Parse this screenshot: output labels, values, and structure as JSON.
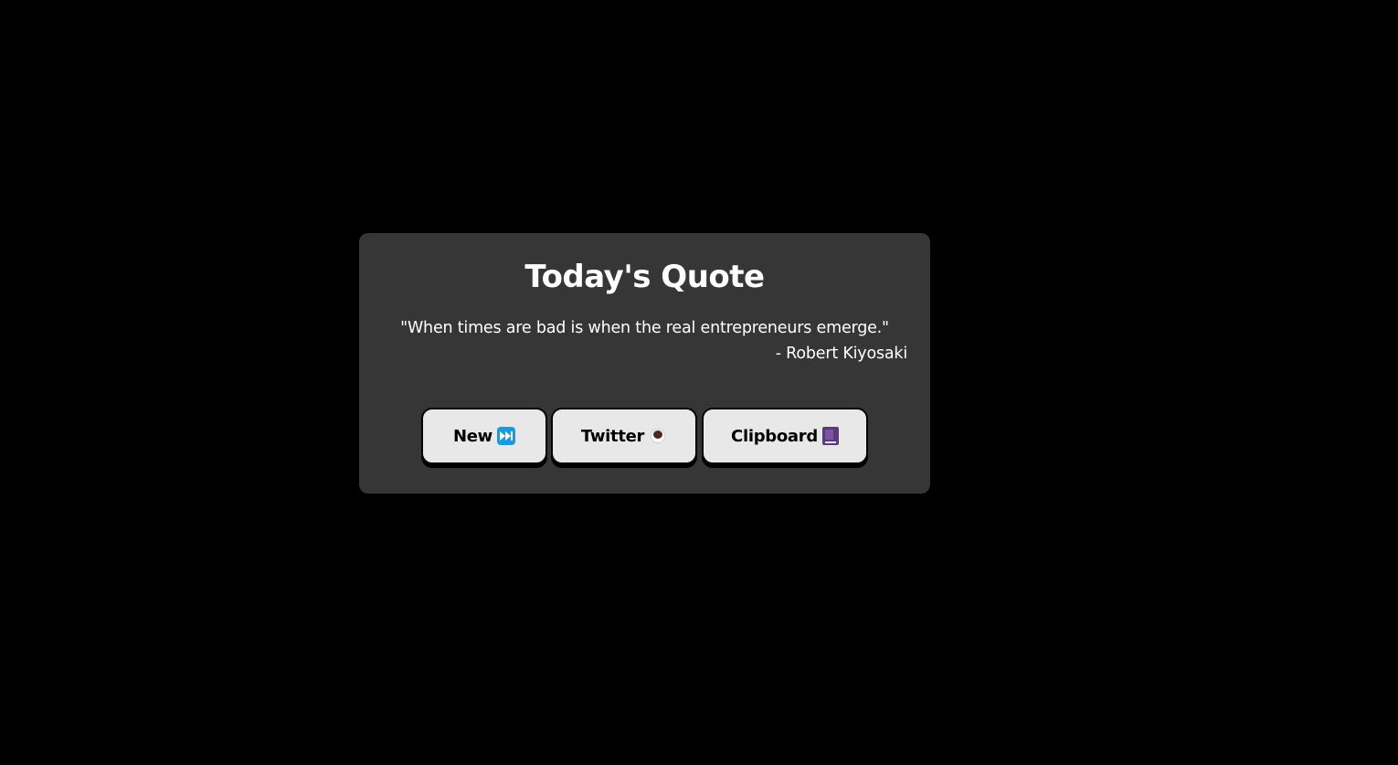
{
  "card": {
    "title": "Today's Quote",
    "quote": "\"When times are bad is when the real entrepreneurs emerge.\"",
    "author": "- Robert Kiyosaki"
  },
  "buttons": {
    "new_label": "New",
    "new_icon": "fast-forward-icon",
    "twitter_label": "Twitter",
    "twitter_icon": "coffee-icon",
    "clipboard_label": "Clipboard",
    "clipboard_icon": "book-icon"
  },
  "colors": {
    "page_background": "#000000",
    "card_background": "#363636",
    "button_background": "#e8e8e8",
    "text_primary": "#ffffff"
  }
}
